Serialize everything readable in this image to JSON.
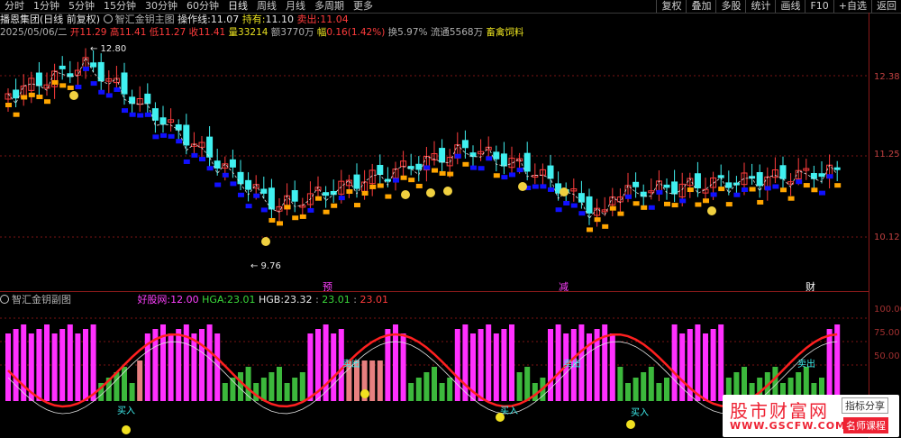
{
  "toolbar": {
    "periods": [
      "分时",
      "1分钟",
      "5分钟",
      "15分钟",
      "30分钟",
      "60分钟",
      "日线",
      "周线",
      "月线",
      "多周期",
      "更多"
    ],
    "active_period": "日线",
    "buttons": [
      "复权",
      "叠加",
      "多股",
      "统计",
      "画线",
      "F10",
      "+自选",
      "返回"
    ]
  },
  "header": {
    "stock": "播恩集团(日线 前复权)",
    "indicator": "智汇金钥主图",
    "op_label": "操作线:",
    "op_value": "11.07",
    "hold_label": "持有:",
    "hold_value": "11.10",
    "sell_label": "卖出:",
    "sell_value": "11.04"
  },
  "quote": {
    "date": "2025/05/06/二",
    "open_label": "开",
    "open": "11.29",
    "high_label": "高",
    "high": "11.41",
    "low_label": "低",
    "low": "11.27",
    "close_label": "收",
    "close": "11.41",
    "vol_label": "量",
    "vol": "33214",
    "amt_label": "额",
    "amt": "3770万",
    "chg_label": "幅",
    "chg": "0.16(1.42%)",
    "turn_label": "换",
    "turn": "5.97%",
    "float_label": "流通",
    "float": "5568万",
    "sector": "畜禽饲料"
  },
  "price_axis": [
    "12.38",
    "11.25",
    "10.12"
  ],
  "annotations": {
    "high_mark": "12.80",
    "low_mark": "9.76"
  },
  "markers": [
    "预",
    "减",
    "财"
  ],
  "sub": {
    "name": "智汇金钥副图",
    "good_label": "好股网:",
    "good_value": "12.00",
    "hga_label": "HGA:",
    "hga_value": "23.01",
    "hgb_label": "HGB:",
    "hgb_value": "23.32",
    "v4": "23.01",
    "v5": "23.01",
    "axis": [
      "100.00",
      "75.00",
      "50.00"
    ],
    "signals": {
      "buy": "买入",
      "sell": "卖出"
    }
  },
  "colors": {
    "up": "#ff3c3c",
    "down": "#40f0f0",
    "ma_up": "#ffa500",
    "ma_down": "#1010ff",
    "pink": "#ff30ff",
    "green_bar": "#3cb83c"
  },
  "watermark": {
    "big": "股市财富网",
    "url": "WWW.GSCFW.COM",
    "tag1": "指标分享",
    "tag2": "名师课程"
  }
}
